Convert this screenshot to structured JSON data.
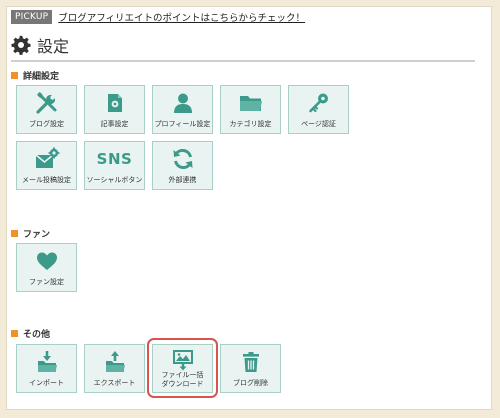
{
  "pickup": {
    "badge": "PICKUP",
    "link": "ブログアフィリエイトのポイントはこちらからチェック！"
  },
  "page": {
    "title": "設定",
    "icon": "gear-icon"
  },
  "sections": {
    "detail": {
      "heading": "詳細設定",
      "tiles": [
        {
          "label": "ブログ設定",
          "icon": "tools-icon"
        },
        {
          "label": "記事設定",
          "icon": "document-icon"
        },
        {
          "label": "プロフィール設定",
          "icon": "person-icon"
        },
        {
          "label": "カテゴリ設定",
          "icon": "folder-icon"
        },
        {
          "label": "ページ認証",
          "icon": "key-icon"
        },
        {
          "label": "メール投稿設定",
          "icon": "mail-gear-icon"
        },
        {
          "label": "ソーシャルボタン",
          "icon": "sns-icon",
          "icon_text": "SNS"
        },
        {
          "label": "外部連携",
          "icon": "sync-icon"
        }
      ]
    },
    "fan": {
      "heading": "ファン",
      "tiles": [
        {
          "label": "ファン設定",
          "icon": "heart-icon"
        }
      ]
    },
    "other": {
      "heading": "その他",
      "tiles": [
        {
          "label": "インポート",
          "icon": "import-icon"
        },
        {
          "label": "エクスポート",
          "icon": "export-icon"
        },
        {
          "label_line1": "ファイル一括",
          "label_line2": "ダウンロード",
          "icon": "file-download-icon"
        },
        {
          "label": "ブログ削除",
          "icon": "trash-icon"
        }
      ]
    }
  },
  "colors": {
    "accent": "#3c9a8a",
    "tile_bg": "#e9f4f2",
    "tile_border": "#a9cfc9",
    "section_marker": "#f0912a",
    "highlight": "#d9534f",
    "frame": "#f3ead8"
  }
}
